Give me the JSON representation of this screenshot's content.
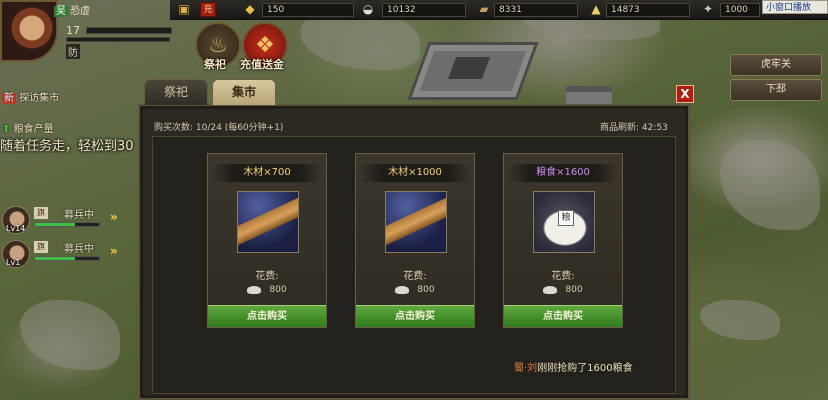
{
  "player": {
    "name_flag": "吴",
    "name": "恐虚",
    "level": "17",
    "guard_label": "防"
  },
  "resources": {
    "recharge_label": "充",
    "gold": "150",
    "silver": "10132",
    "wood": "8331",
    "grain": "14873",
    "iron": "1000"
  },
  "popup_button": "小窗口播放",
  "top_icons": [
    {
      "label": "祭祀",
      "icon": "cauldron-icon"
    },
    {
      "label": "充值送金",
      "icon": "gift-box-icon"
    }
  ],
  "left_panel": {
    "explore_flag": "新",
    "explore": "探访集市",
    "food_production": "粮食产量",
    "scroll_text": "随着任务走，轻松到30",
    "troops": [
      {
        "level": "Lv14",
        "flag": "旗",
        "status": "募兵中",
        "hp": 0.62
      },
      {
        "level": "Lv1",
        "flag": "旗",
        "status": "募兵中",
        "hp": 0.62
      }
    ]
  },
  "cities": [
    "虎牢关",
    "下邳"
  ],
  "dialog": {
    "tabs": [
      "祭祀",
      "集市"
    ],
    "active_tab": "集市",
    "close": "X",
    "purchase_count": "购买次数: 10/24 (每60分钟+1)",
    "refresh": "商品刷新: 42:53",
    "items": [
      {
        "title": "木材×700",
        "kind": "wood",
        "cost_label": "花费:",
        "price": "800",
        "buy": "点击购买"
      },
      {
        "title": "木材×1000",
        "kind": "wood",
        "cost_label": "花费:",
        "price": "800",
        "buy": "点击购买"
      },
      {
        "title": "粮食×1600",
        "kind": "grain",
        "cost_label": "花费:",
        "price": "800",
        "buy": "点击购买"
      }
    ],
    "notice_user": "蜀·刘",
    "notice_text": "刚刚抢购了1600粮食"
  },
  "colors": {
    "wood_title": "#f0cf7a",
    "grain_title": "#c98bf0",
    "buy_button": "#3f8f28",
    "close_button": "#b01d12"
  }
}
